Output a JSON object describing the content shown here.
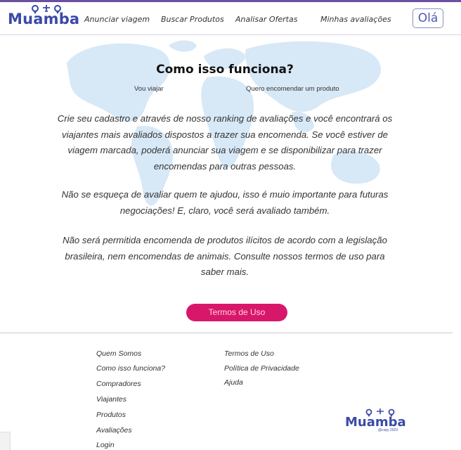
{
  "brand": {
    "name": "Muamba",
    "copyright": "@copy 2023"
  },
  "nav": {
    "items": [
      {
        "label": "Anunciar viagem"
      },
      {
        "label": "Buscar Produtos"
      },
      {
        "label": "Analisar Ofertas"
      },
      {
        "label": "Minhas avaliações"
      }
    ],
    "greeting": "Olá"
  },
  "hero": {
    "title": "Como isso funciona?",
    "tabs": [
      {
        "label": "Vou viajar"
      },
      {
        "label": "Quero encomendar um produto"
      }
    ],
    "paragraphs": [
      "Crie seu cadastro e através de nosso ranking de avaliações e você encontrará os viajantes mais avaliados dispostos a trazer sua encomenda. Se você estiver de viagem marcada, poderá anunciar sua viagem e se disponibilizar para trazer encomendas para outras pessoas.",
      "Não se esqueça de avaliar quem te ajudou, isso é muio importante para futuras negociações! E, claro, você será avaliado também.",
      "Não será permitida encomenda de produtos ilícitos de acordo com a legislação brasileira, nem encomendas de animais.  Consulte nossos termos de uso para saber mais."
    ],
    "cta": "Termos de Uso"
  },
  "footer": {
    "col1": [
      "Quem Somos",
      "Como isso funciona?",
      "Compradores",
      "Viajantes",
      "Produtos",
      "Avaliações",
      "Login"
    ],
    "col2": [
      "Termos de Uso",
      "Política de Privacidade",
      "Ajuda"
    ]
  },
  "colors": {
    "brand": "#3a4aa8",
    "accent": "#d8176b",
    "map": "#d7e8f7"
  },
  "icons": {
    "logo_mark": "plane-and-pins-icon"
  }
}
